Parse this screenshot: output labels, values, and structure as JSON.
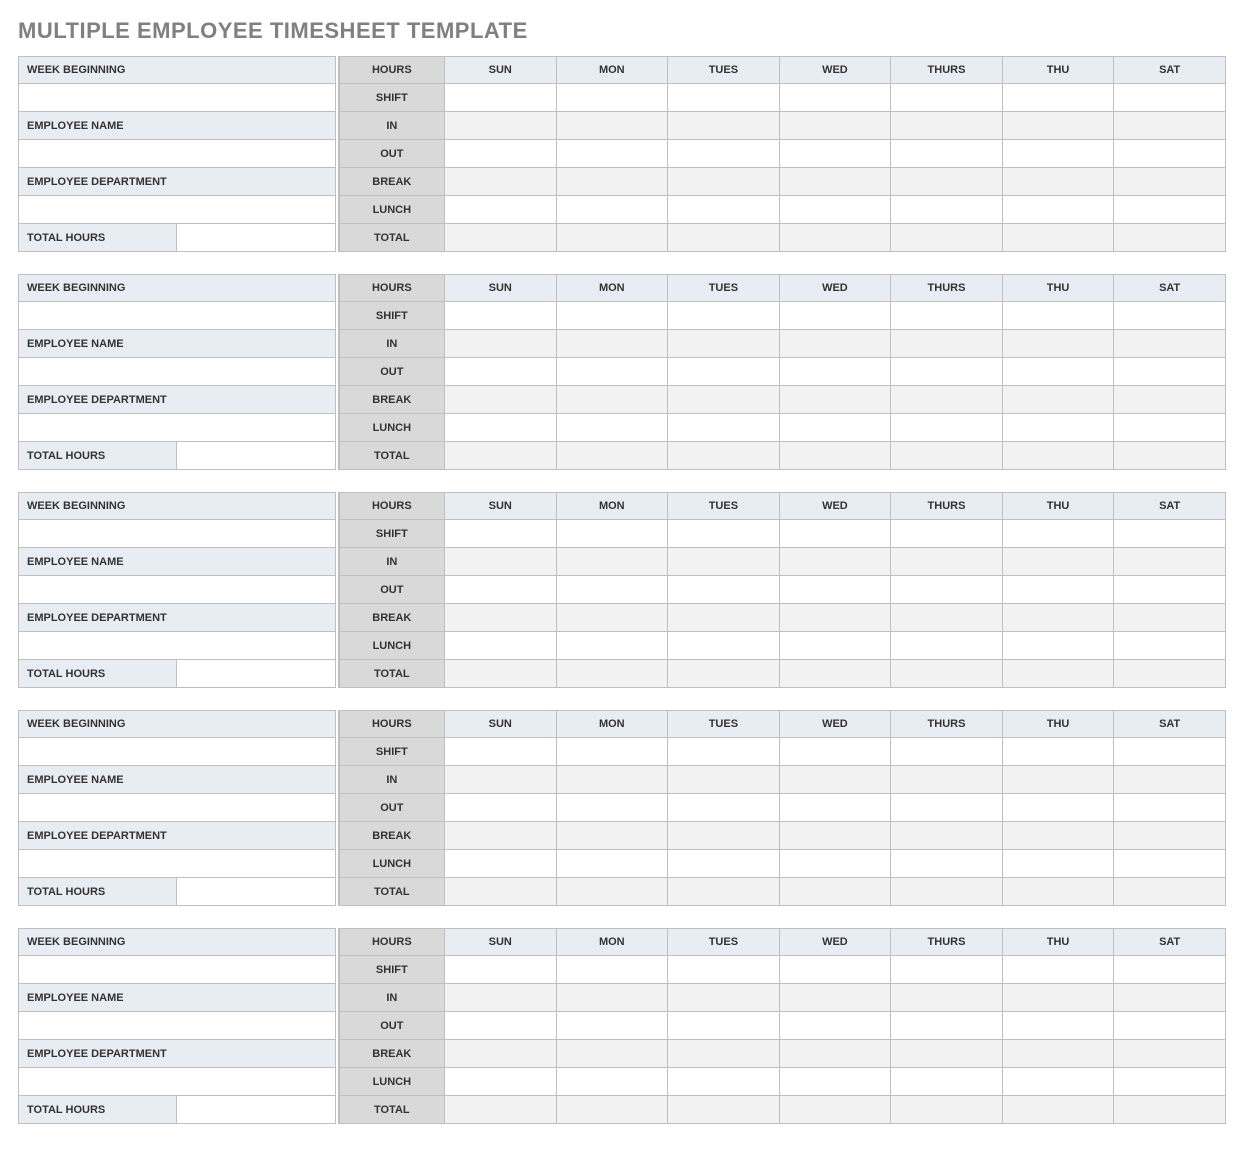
{
  "title": "MULTIPLE EMPLOYEE TIMESHEET TEMPLATE",
  "labels": {
    "week_beginning": "WEEK BEGINNING",
    "employee_name": "EMPLOYEE NAME",
    "employee_department": "EMPLOYEE DEPARTMENT",
    "total_hours": "TOTAL HOURS",
    "hours": "HOURS",
    "shift": "SHIFT",
    "in": "IN",
    "out": "OUT",
    "break": "BREAK",
    "lunch": "LUNCH",
    "total": "TOTAL"
  },
  "days": [
    "SUN",
    "MON",
    "TUES",
    "WED",
    "THURS",
    "THU",
    "SAT"
  ],
  "blocks": [
    {
      "week_beginning": "",
      "employee_name": "",
      "employee_department": "",
      "total_hours": "",
      "rows": {
        "shift": [
          "",
          "",
          "",
          "",
          "",
          "",
          ""
        ],
        "in": [
          "",
          "",
          "",
          "",
          "",
          "",
          ""
        ],
        "out": [
          "",
          "",
          "",
          "",
          "",
          "",
          ""
        ],
        "break": [
          "",
          "",
          "",
          "",
          "",
          "",
          ""
        ],
        "lunch": [
          "",
          "",
          "",
          "",
          "",
          "",
          ""
        ],
        "total": [
          "",
          "",
          "",
          "",
          "",
          "",
          ""
        ]
      }
    },
    {
      "week_beginning": "",
      "employee_name": "",
      "employee_department": "",
      "total_hours": "",
      "rows": {
        "shift": [
          "",
          "",
          "",
          "",
          "",
          "",
          ""
        ],
        "in": [
          "",
          "",
          "",
          "",
          "",
          "",
          ""
        ],
        "out": [
          "",
          "",
          "",
          "",
          "",
          "",
          ""
        ],
        "break": [
          "",
          "",
          "",
          "",
          "",
          "",
          ""
        ],
        "lunch": [
          "",
          "",
          "",
          "",
          "",
          "",
          ""
        ],
        "total": [
          "",
          "",
          "",
          "",
          "",
          "",
          ""
        ]
      }
    },
    {
      "week_beginning": "",
      "employee_name": "",
      "employee_department": "",
      "total_hours": "",
      "rows": {
        "shift": [
          "",
          "",
          "",
          "",
          "",
          "",
          ""
        ],
        "in": [
          "",
          "",
          "",
          "",
          "",
          "",
          ""
        ],
        "out": [
          "",
          "",
          "",
          "",
          "",
          "",
          ""
        ],
        "break": [
          "",
          "",
          "",
          "",
          "",
          "",
          ""
        ],
        "lunch": [
          "",
          "",
          "",
          "",
          "",
          "",
          ""
        ],
        "total": [
          "",
          "",
          "",
          "",
          "",
          "",
          ""
        ]
      }
    },
    {
      "week_beginning": "",
      "employee_name": "",
      "employee_department": "",
      "total_hours": "",
      "rows": {
        "shift": [
          "",
          "",
          "",
          "",
          "",
          "",
          ""
        ],
        "in": [
          "",
          "",
          "",
          "",
          "",
          "",
          ""
        ],
        "out": [
          "",
          "",
          "",
          "",
          "",
          "",
          ""
        ],
        "break": [
          "",
          "",
          "",
          "",
          "",
          "",
          ""
        ],
        "lunch": [
          "",
          "",
          "",
          "",
          "",
          "",
          ""
        ],
        "total": [
          "",
          "",
          "",
          "",
          "",
          "",
          ""
        ]
      }
    },
    {
      "week_beginning": "",
      "employee_name": "",
      "employee_department": "",
      "total_hours": "",
      "rows": {
        "shift": [
          "",
          "",
          "",
          "",
          "",
          "",
          ""
        ],
        "in": [
          "",
          "",
          "",
          "",
          "",
          "",
          ""
        ],
        "out": [
          "",
          "",
          "",
          "",
          "",
          "",
          ""
        ],
        "break": [
          "",
          "",
          "",
          "",
          "",
          "",
          ""
        ],
        "lunch": [
          "",
          "",
          "",
          "",
          "",
          "",
          ""
        ],
        "total": [
          "",
          "",
          "",
          "",
          "",
          "",
          ""
        ]
      }
    }
  ]
}
